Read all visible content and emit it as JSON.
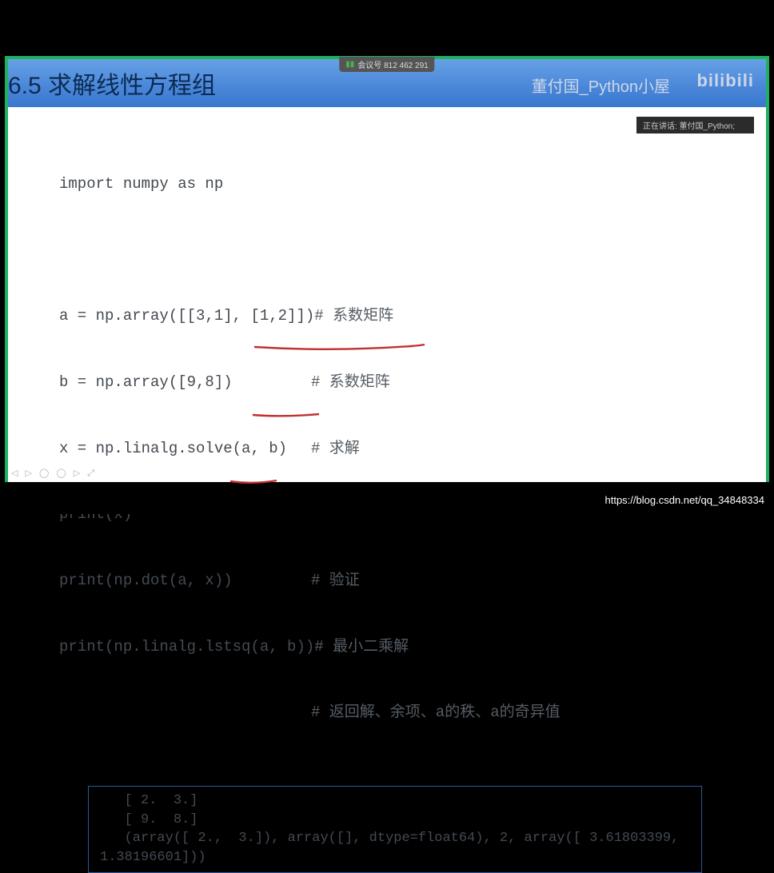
{
  "meeting": {
    "label": "会议号 812 462 291"
  },
  "speaking": {
    "label": "正在讲话: 董付国_Python;"
  },
  "header": {
    "title": "6.5  求解线性方程组",
    "author": "董付国_Python小屋",
    "logo": "bilibili"
  },
  "code": {
    "l1": "import numpy as np",
    "l2_left": "a = np.array([[3,1], [1,2]])",
    "l2_cmt": "# 系数矩阵",
    "l3_left": "b = np.array([9,8])",
    "l3_cmt": "# 系数矩阵",
    "l4_left": "x = np.linalg.solve(a, b)",
    "l4_cmt": "# 求解",
    "l5": "print(x)",
    "l6_left": "print(np.dot(a, x))",
    "l6_cmt": "# 验证",
    "l7_left": "print(np.linalg.lstsq(a, b))",
    "l7_cmt": "# 最小二乘解",
    "l8_cmt": "# 返回解、余项、a的秩、a的奇异值"
  },
  "output": {
    "line1": "   [ 2.  3.]",
    "line2": "   [ 9.  8.]",
    "line3": "   (array([ 2.,  3.]), array([], dtype=float64), 2, array([ 3.61803399,",
    "line4": "1.38196601]))"
  },
  "footer": {
    "url": "https://blog.csdn.net/qq_34848334"
  }
}
